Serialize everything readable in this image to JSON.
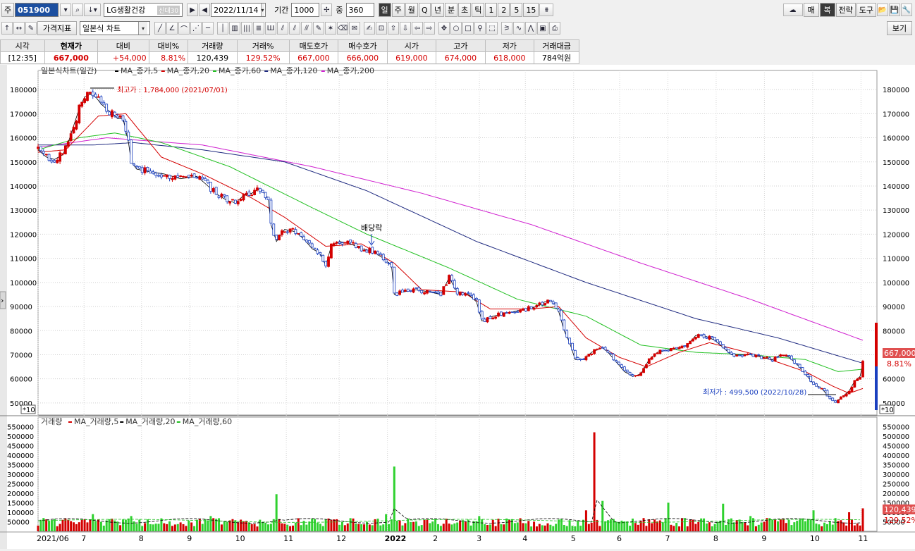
{
  "toolbar": {
    "market_label": "주",
    "code": "051900",
    "stock_name": "LG생활건강",
    "credit_badge": "신대30",
    "date": "2022/11/14",
    "period_label": "기간",
    "period_value": "1000",
    "weight_label": "중",
    "weight_value": "360",
    "timeframes": [
      "일",
      "주",
      "월",
      "Q",
      "년",
      "분",
      "초",
      "틱",
      "1",
      "2",
      "5",
      "15"
    ],
    "active_timeframe": "일",
    "right_buttons": [
      "매",
      "복",
      "전략",
      "도구"
    ],
    "indicator_menu": "가격지표",
    "chart_type": "일본식 차트",
    "view_button": "보기"
  },
  "quote": {
    "headers": [
      "시각",
      "현재가",
      "대비",
      "대비%",
      "거래량",
      "거래%",
      "매도호가",
      "매수호가",
      "시가",
      "고가",
      "저가",
      "거래대금"
    ],
    "values": [
      "[12:35]",
      "667,000",
      "+54,000",
      "8.81%",
      "120,439",
      "129.52%",
      "667,000",
      "666,000",
      "619,000",
      "674,000",
      "618,000",
      "784억원"
    ]
  },
  "price_panel": {
    "legend_title": "일본식차트(일간)",
    "legend_items": [
      {
        "label": "MA_종가,5",
        "color": "#000000"
      },
      {
        "label": "MA_종가,20",
        "color": "#d40000"
      },
      {
        "label": "MA_종가,60",
        "color": "#22c022"
      },
      {
        "label": "MA_종가,120",
        "color": "#1f2a80"
      },
      {
        "label": "MA_종가,200",
        "color": "#d020d0"
      }
    ],
    "high_annotation": "최고가 : 1,784,000 (2021/07/01)",
    "low_annotation": "최저가 : 499,500 (2022/10/28)",
    "dividend_annotation": "배당락",
    "current_price_tag": "667,000",
    "change_tag": "8.81%",
    "multiplier": "*10",
    "y_ticks": [
      "180000",
      "170000",
      "160000",
      "150000",
      "140000",
      "130000",
      "120000",
      "110000",
      "100000",
      "90000",
      "80000",
      "70000",
      "60000",
      "50000"
    ]
  },
  "volume_panel": {
    "legend_title": "거래량",
    "legend_items": [
      {
        "label": "MA_거래량,5",
        "color": "#d40000"
      },
      {
        "label": "MA_거래량,20",
        "color": "#000000"
      },
      {
        "label": "MA_거래량,60",
        "color": "#22c022"
      }
    ],
    "current_volume_tag": "120,439",
    "volume_pct_tag": "129.52%",
    "y_ticks": [
      "550000",
      "500000",
      "450000",
      "400000",
      "350000",
      "300000",
      "250000",
      "200000",
      "150000",
      "100000",
      "50000"
    ]
  },
  "x_axis": {
    "labels": [
      "2021/06",
      "7",
      "8",
      "9",
      "10",
      "11",
      "12",
      "2022",
      "2",
      "3",
      "4",
      "5",
      "6",
      "7",
      "8",
      "9",
      "10",
      "11"
    ]
  },
  "colors": {
    "up": "#d40000",
    "down": "#1a3fbf",
    "vol_up": "#d40000",
    "vol_down": "#2fd12f"
  },
  "chart_data": {
    "type": "candlestick",
    "unit_multiplier": 10,
    "ylim": [
      45000,
      185000
    ],
    "vol_ylim": [
      0,
      570000
    ],
    "price_path": [
      [
        0,
        155000
      ],
      [
        3,
        152000
      ],
      [
        6,
        151000
      ],
      [
        9,
        153000
      ],
      [
        11,
        158000
      ],
      [
        13,
        165000
      ],
      [
        15,
        172000
      ],
      [
        17,
        177000
      ],
      [
        19,
        178000
      ],
      [
        21,
        177000
      ],
      [
        23,
        174000
      ],
      [
        25,
        172000
      ],
      [
        27,
        170000
      ],
      [
        29,
        168000
      ],
      [
        31,
        168000
      ],
      [
        33,
        158000
      ],
      [
        34,
        150000
      ],
      [
        36,
        147000
      ],
      [
        40,
        146000
      ],
      [
        46,
        145000
      ],
      [
        52,
        143000
      ],
      [
        58,
        144000
      ],
      [
        63,
        139000
      ],
      [
        66,
        136000
      ],
      [
        69,
        134000
      ],
      [
        72,
        133000
      ],
      [
        75,
        136000
      ],
      [
        78,
        137000
      ],
      [
        81,
        139000
      ],
      [
        84,
        135000
      ],
      [
        85,
        124000
      ],
      [
        87,
        117000
      ],
      [
        90,
        122000
      ],
      [
        94,
        121000
      ],
      [
        97,
        118000
      ],
      [
        100,
        114000
      ],
      [
        103,
        112000
      ],
      [
        105,
        107000
      ],
      [
        107,
        115000
      ],
      [
        110,
        117000
      ],
      [
        114,
        116000
      ],
      [
        118,
        114000
      ],
      [
        122,
        113000
      ],
      [
        126,
        110000
      ],
      [
        129,
        107000
      ],
      [
        130,
        95000
      ],
      [
        133,
        96000
      ],
      [
        138,
        97000
      ],
      [
        143,
        96000
      ],
      [
        147,
        95000
      ],
      [
        150,
        102000
      ],
      [
        153,
        96000
      ],
      [
        157,
        95000
      ],
      [
        160,
        92000
      ],
      [
        162,
        84000
      ],
      [
        166,
        86000
      ],
      [
        170,
        87000
      ],
      [
        174,
        88000
      ],
      [
        178,
        89000
      ],
      [
        182,
        90000
      ],
      [
        185,
        92000
      ],
      [
        188,
        92000
      ],
      [
        190,
        88000
      ],
      [
        192,
        80000
      ],
      [
        194,
        75000
      ],
      [
        196,
        68000
      ],
      [
        199,
        68000
      ],
      [
        202,
        71000
      ],
      [
        206,
        73000
      ],
      [
        208,
        71000
      ],
      [
        211,
        67000
      ],
      [
        214,
        63000
      ],
      [
        217,
        61000
      ],
      [
        220,
        62000
      ],
      [
        223,
        68000
      ],
      [
        226,
        71000
      ],
      [
        230,
        72000
      ],
      [
        234,
        73000
      ],
      [
        237,
        74000
      ],
      [
        240,
        78000
      ],
      [
        243,
        78000
      ],
      [
        247,
        76000
      ],
      [
        250,
        73000
      ],
      [
        253,
        70000
      ],
      [
        256,
        70000
      ],
      [
        260,
        70000
      ],
      [
        264,
        69000
      ],
      [
        268,
        68000
      ],
      [
        271,
        70000
      ],
      [
        274,
        69000
      ],
      [
        277,
        66000
      ],
      [
        280,
        62000
      ],
      [
        283,
        58000
      ],
      [
        286,
        56000
      ],
      [
        289,
        52000
      ],
      [
        291,
        50500
      ],
      [
        293,
        52000
      ],
      [
        296,
        55000
      ],
      [
        298,
        59000
      ],
      [
        300,
        61000
      ],
      [
        301,
        66700
      ]
    ],
    "ma200_path": [
      [
        0,
        156000
      ],
      [
        25,
        160000
      ],
      [
        60,
        157000
      ],
      [
        100,
        148000
      ],
      [
        140,
        137000
      ],
      [
        180,
        124000
      ],
      [
        220,
        108000
      ],
      [
        260,
        93000
      ],
      [
        301,
        76000
      ]
    ],
    "ma120_path": [
      [
        0,
        157000
      ],
      [
        20,
        157000
      ],
      [
        35,
        158000
      ],
      [
        60,
        155000
      ],
      [
        90,
        150000
      ],
      [
        120,
        138000
      ],
      [
        160,
        117000
      ],
      [
        200,
        100000
      ],
      [
        240,
        85000
      ],
      [
        270,
        77000
      ],
      [
        301,
        66500
      ]
    ],
    "ma60_path": [
      [
        0,
        155000
      ],
      [
        15,
        160000
      ],
      [
        28,
        162000
      ],
      [
        45,
        158000
      ],
      [
        70,
        148000
      ],
      [
        100,
        131000
      ],
      [
        120,
        120000
      ],
      [
        150,
        106000
      ],
      [
        175,
        93000
      ],
      [
        200,
        86000
      ],
      [
        220,
        74000
      ],
      [
        240,
        71000
      ],
      [
        260,
        70000
      ],
      [
        280,
        68000
      ],
      [
        292,
        63000
      ],
      [
        301,
        64000
      ]
    ],
    "ma20_path": [
      [
        0,
        154000
      ],
      [
        10,
        155000
      ],
      [
        22,
        169000
      ],
      [
        32,
        170000
      ],
      [
        45,
        152000
      ],
      [
        60,
        145000
      ],
      [
        78,
        135000
      ],
      [
        90,
        127000
      ],
      [
        105,
        115000
      ],
      [
        118,
        116000
      ],
      [
        130,
        108000
      ],
      [
        140,
        97000
      ],
      [
        155,
        96000
      ],
      [
        165,
        89000
      ],
      [
        180,
        89000
      ],
      [
        190,
        90000
      ],
      [
        200,
        77000
      ],
      [
        212,
        69000
      ],
      [
        222,
        65000
      ],
      [
        234,
        71000
      ],
      [
        245,
        75000
      ],
      [
        262,
        70000
      ],
      [
        280,
        63000
      ],
      [
        290,
        57000
      ],
      [
        296,
        54000
      ],
      [
        301,
        56000
      ]
    ],
    "volume_spikes": [
      [
        0,
        30000
      ],
      [
        20,
        90000
      ],
      [
        34,
        80000
      ],
      [
        63,
        80000
      ],
      [
        87,
        195000
      ],
      [
        127,
        90000
      ],
      [
        130,
        340000
      ],
      [
        161,
        80000
      ],
      [
        200,
        110000
      ],
      [
        203,
        520000
      ],
      [
        206,
        160000
      ],
      [
        230,
        150000
      ],
      [
        250,
        145000
      ],
      [
        260,
        80000
      ],
      [
        283,
        110000
      ],
      [
        296,
        100000
      ],
      [
        301,
        120439
      ]
    ]
  }
}
